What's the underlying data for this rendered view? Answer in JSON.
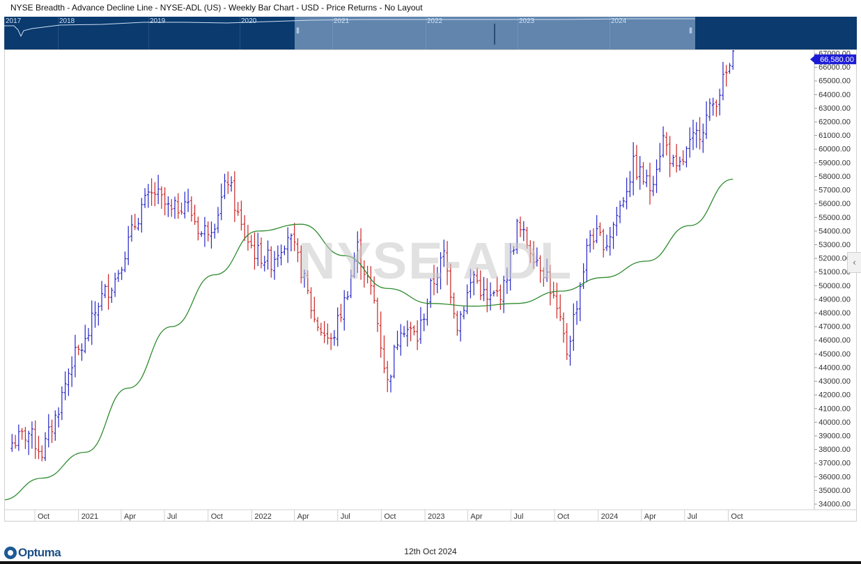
{
  "header": {
    "title": "NYSE Breadth - Advance Decline Line - NYSE-ADL (US) - Weekly Bar Chart - USD - Price Returns - No Layout"
  },
  "navigator": {
    "years": [
      "2017",
      "2018",
      "2019",
      "2020",
      "2021",
      "2022",
      "2023",
      "2024"
    ]
  },
  "watermark": "NYSE-ADL",
  "footer": {
    "logo": "Optuma",
    "date": "12th Oct 2024"
  },
  "colors": {
    "up_bar": "#2323c8",
    "down_bar": "#cc2222",
    "moving_average": "#2e8b2e",
    "navigator_bg": "#0a3a6e",
    "price_label_bg": "#1a1ad6"
  },
  "chart_data": {
    "type": "bar",
    "title": "NYSE Breadth - Advance Decline Line - NYSE-ADL (US) - Weekly Bar Chart - USD - Price Returns - No Layout",
    "ylim": [
      34000,
      67000
    ],
    "y_ticks": [
      "67000.00",
      "66000.00",
      "65000.00",
      "64000.00",
      "63000.00",
      "62000.00",
      "61000.00",
      "60000.00",
      "59000.00",
      "58000.00",
      "57000.00",
      "56000.00",
      "55000.00",
      "54000.00",
      "53000.00",
      "52000.00",
      "51000.00",
      "50000.00",
      "49000.00",
      "48000.00",
      "47000.00",
      "46000.00",
      "45000.00",
      "44000.00",
      "43000.00",
      "42000.00",
      "41000.00",
      "40000.00",
      "39000.00",
      "38000.00",
      "37000.00",
      "36000.00",
      "35000.00",
      "34000.00"
    ],
    "x_ticks": [
      "Oct",
      "2021",
      "Apr",
      "Jul",
      "Oct",
      "2022",
      "Apr",
      "Jul",
      "Oct",
      "2023",
      "Apr",
      "Jul",
      "Oct",
      "2024",
      "Apr",
      "Jul",
      "Oct"
    ],
    "last_price_label": "66,580.00",
    "last_value": 66580,
    "legend": "none",
    "grid": false,
    "anchors": [
      {
        "date": "2020-08-14",
        "value": 38500
      },
      {
        "date": "2020-09-18",
        "value": 39200
      },
      {
        "date": "2020-10-16",
        "value": 37800
      },
      {
        "date": "2020-11-13",
        "value": 40300
      },
      {
        "date": "2020-12-18",
        "value": 44500
      },
      {
        "date": "2021-01-15",
        "value": 45800
      },
      {
        "date": "2021-02-12",
        "value": 48800
      },
      {
        "date": "2021-03-19",
        "value": 50500
      },
      {
        "date": "2021-04-16",
        "value": 53200
      },
      {
        "date": "2021-05-14",
        "value": 55800
      },
      {
        "date": "2021-06-11",
        "value": 56800
      },
      {
        "date": "2021-07-16",
        "value": 55300
      },
      {
        "date": "2021-08-13",
        "value": 56300
      },
      {
        "date": "2021-09-17",
        "value": 53800
      },
      {
        "date": "2021-10-15",
        "value": 54800
      },
      {
        "date": "2021-11-12",
        "value": 57800
      },
      {
        "date": "2021-12-10",
        "value": 54200
      },
      {
        "date": "2022-01-07",
        "value": 52500
      },
      {
        "date": "2022-02-11",
        "value": 51800
      },
      {
        "date": "2022-03-18",
        "value": 53800
      },
      {
        "date": "2022-04-15",
        "value": 51200
      },
      {
        "date": "2022-05-13",
        "value": 47500
      },
      {
        "date": "2022-06-17",
        "value": 45800
      },
      {
        "date": "2022-07-15",
        "value": 48800
      },
      {
        "date": "2022-08-12",
        "value": 52800
      },
      {
        "date": "2022-09-16",
        "value": 48800
      },
      {
        "date": "2022-10-14",
        "value": 42800
      },
      {
        "date": "2022-11-11",
        "value": 47200
      },
      {
        "date": "2022-12-16",
        "value": 46200
      },
      {
        "date": "2023-01-13",
        "value": 49800
      },
      {
        "date": "2023-02-10",
        "value": 52200
      },
      {
        "date": "2023-03-10",
        "value": 47200
      },
      {
        "date": "2023-04-14",
        "value": 50800
      },
      {
        "date": "2023-05-12",
        "value": 48800
      },
      {
        "date": "2023-06-16",
        "value": 49800
      },
      {
        "date": "2023-07-14",
        "value": 54300
      },
      {
        "date": "2023-08-11",
        "value": 52800
      },
      {
        "date": "2023-09-15",
        "value": 50800
      },
      {
        "date": "2023-10-27",
        "value": 45200
      },
      {
        "date": "2023-11-17",
        "value": 48800
      },
      {
        "date": "2023-12-15",
        "value": 53800
      },
      {
        "date": "2024-01-19",
        "value": 53200
      },
      {
        "date": "2024-02-16",
        "value": 55800
      },
      {
        "date": "2024-03-15",
        "value": 58800
      },
      {
        "date": "2024-04-19",
        "value": 57200
      },
      {
        "date": "2024-05-17",
        "value": 60800
      },
      {
        "date": "2024-06-14",
        "value": 58200
      },
      {
        "date": "2024-07-12",
        "value": 60200
      },
      {
        "date": "2024-08-09",
        "value": 61800
      },
      {
        "date": "2024-09-06",
        "value": 63800
      },
      {
        "date": "2024-10-11",
        "value": 66580
      }
    ],
    "moving_average": {
      "anchors": [
        {
          "date": "2020-07-24",
          "value": 34300
        },
        {
          "date": "2020-10-16",
          "value": 35900
        },
        {
          "date": "2021-01-15",
          "value": 37800
        },
        {
          "date": "2021-04-16",
          "value": 42500
        },
        {
          "date": "2021-07-16",
          "value": 47000
        },
        {
          "date": "2021-10-15",
          "value": 50800
        },
        {
          "date": "2022-01-14",
          "value": 54000
        },
        {
          "date": "2022-04-15",
          "value": 54500
        },
        {
          "date": "2022-07-15",
          "value": 52200
        },
        {
          "date": "2022-10-14",
          "value": 49800
        },
        {
          "date": "2023-01-13",
          "value": 48700
        },
        {
          "date": "2023-04-14",
          "value": 48500
        },
        {
          "date": "2023-07-14",
          "value": 48700
        },
        {
          "date": "2023-10-13",
          "value": 49600
        },
        {
          "date": "2024-01-12",
          "value": 50600
        },
        {
          "date": "2024-04-12",
          "value": 51800
        },
        {
          "date": "2024-07-12",
          "value": 54400
        },
        {
          "date": "2024-10-11",
          "value": 57800
        }
      ]
    }
  }
}
